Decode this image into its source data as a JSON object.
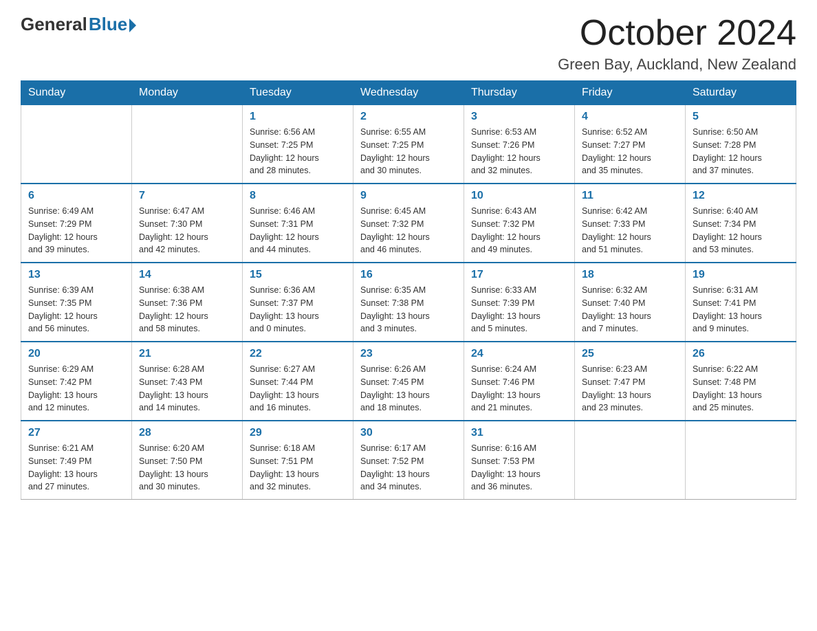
{
  "logo": {
    "general": "General",
    "blue": "Blue",
    "arrow": "▶"
  },
  "title": "October 2024",
  "location": "Green Bay, Auckland, New Zealand",
  "days_of_week": [
    "Sunday",
    "Monday",
    "Tuesday",
    "Wednesday",
    "Thursday",
    "Friday",
    "Saturday"
  ],
  "weeks": [
    [
      {
        "day": "",
        "info": ""
      },
      {
        "day": "",
        "info": ""
      },
      {
        "day": "1",
        "info": "Sunrise: 6:56 AM\nSunset: 7:25 PM\nDaylight: 12 hours\nand 28 minutes."
      },
      {
        "day": "2",
        "info": "Sunrise: 6:55 AM\nSunset: 7:25 PM\nDaylight: 12 hours\nand 30 minutes."
      },
      {
        "day": "3",
        "info": "Sunrise: 6:53 AM\nSunset: 7:26 PM\nDaylight: 12 hours\nand 32 minutes."
      },
      {
        "day": "4",
        "info": "Sunrise: 6:52 AM\nSunset: 7:27 PM\nDaylight: 12 hours\nand 35 minutes."
      },
      {
        "day": "5",
        "info": "Sunrise: 6:50 AM\nSunset: 7:28 PM\nDaylight: 12 hours\nand 37 minutes."
      }
    ],
    [
      {
        "day": "6",
        "info": "Sunrise: 6:49 AM\nSunset: 7:29 PM\nDaylight: 12 hours\nand 39 minutes."
      },
      {
        "day": "7",
        "info": "Sunrise: 6:47 AM\nSunset: 7:30 PM\nDaylight: 12 hours\nand 42 minutes."
      },
      {
        "day": "8",
        "info": "Sunrise: 6:46 AM\nSunset: 7:31 PM\nDaylight: 12 hours\nand 44 minutes."
      },
      {
        "day": "9",
        "info": "Sunrise: 6:45 AM\nSunset: 7:32 PM\nDaylight: 12 hours\nand 46 minutes."
      },
      {
        "day": "10",
        "info": "Sunrise: 6:43 AM\nSunset: 7:32 PM\nDaylight: 12 hours\nand 49 minutes."
      },
      {
        "day": "11",
        "info": "Sunrise: 6:42 AM\nSunset: 7:33 PM\nDaylight: 12 hours\nand 51 minutes."
      },
      {
        "day": "12",
        "info": "Sunrise: 6:40 AM\nSunset: 7:34 PM\nDaylight: 12 hours\nand 53 minutes."
      }
    ],
    [
      {
        "day": "13",
        "info": "Sunrise: 6:39 AM\nSunset: 7:35 PM\nDaylight: 12 hours\nand 56 minutes."
      },
      {
        "day": "14",
        "info": "Sunrise: 6:38 AM\nSunset: 7:36 PM\nDaylight: 12 hours\nand 58 minutes."
      },
      {
        "day": "15",
        "info": "Sunrise: 6:36 AM\nSunset: 7:37 PM\nDaylight: 13 hours\nand 0 minutes."
      },
      {
        "day": "16",
        "info": "Sunrise: 6:35 AM\nSunset: 7:38 PM\nDaylight: 13 hours\nand 3 minutes."
      },
      {
        "day": "17",
        "info": "Sunrise: 6:33 AM\nSunset: 7:39 PM\nDaylight: 13 hours\nand 5 minutes."
      },
      {
        "day": "18",
        "info": "Sunrise: 6:32 AM\nSunset: 7:40 PM\nDaylight: 13 hours\nand 7 minutes."
      },
      {
        "day": "19",
        "info": "Sunrise: 6:31 AM\nSunset: 7:41 PM\nDaylight: 13 hours\nand 9 minutes."
      }
    ],
    [
      {
        "day": "20",
        "info": "Sunrise: 6:29 AM\nSunset: 7:42 PM\nDaylight: 13 hours\nand 12 minutes."
      },
      {
        "day": "21",
        "info": "Sunrise: 6:28 AM\nSunset: 7:43 PM\nDaylight: 13 hours\nand 14 minutes."
      },
      {
        "day": "22",
        "info": "Sunrise: 6:27 AM\nSunset: 7:44 PM\nDaylight: 13 hours\nand 16 minutes."
      },
      {
        "day": "23",
        "info": "Sunrise: 6:26 AM\nSunset: 7:45 PM\nDaylight: 13 hours\nand 18 minutes."
      },
      {
        "day": "24",
        "info": "Sunrise: 6:24 AM\nSunset: 7:46 PM\nDaylight: 13 hours\nand 21 minutes."
      },
      {
        "day": "25",
        "info": "Sunrise: 6:23 AM\nSunset: 7:47 PM\nDaylight: 13 hours\nand 23 minutes."
      },
      {
        "day": "26",
        "info": "Sunrise: 6:22 AM\nSunset: 7:48 PM\nDaylight: 13 hours\nand 25 minutes."
      }
    ],
    [
      {
        "day": "27",
        "info": "Sunrise: 6:21 AM\nSunset: 7:49 PM\nDaylight: 13 hours\nand 27 minutes."
      },
      {
        "day": "28",
        "info": "Sunrise: 6:20 AM\nSunset: 7:50 PM\nDaylight: 13 hours\nand 30 minutes."
      },
      {
        "day": "29",
        "info": "Sunrise: 6:18 AM\nSunset: 7:51 PM\nDaylight: 13 hours\nand 32 minutes."
      },
      {
        "day": "30",
        "info": "Sunrise: 6:17 AM\nSunset: 7:52 PM\nDaylight: 13 hours\nand 34 minutes."
      },
      {
        "day": "31",
        "info": "Sunrise: 6:16 AM\nSunset: 7:53 PM\nDaylight: 13 hours\nand 36 minutes."
      },
      {
        "day": "",
        "info": ""
      },
      {
        "day": "",
        "info": ""
      }
    ]
  ]
}
